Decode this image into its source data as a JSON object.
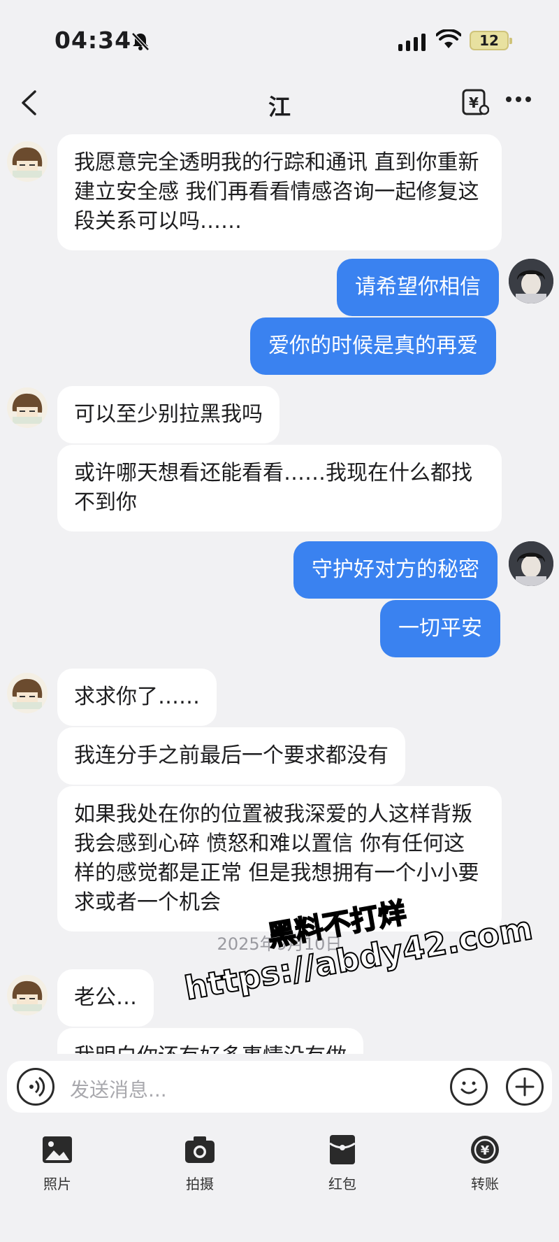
{
  "status": {
    "time": "04:34",
    "battery": "12"
  },
  "header": {
    "title": "江"
  },
  "messages": [
    {
      "side": "in",
      "text": "我愿意完全透明我的行踪和通讯 直到你重新建立安全感 我们再看看情感咨询一起修复这段关系可以吗……"
    },
    {
      "side": "out",
      "text": "请希望你相信"
    },
    {
      "side": "out",
      "text": "爱你的时候是真的再爱"
    },
    {
      "side": "in",
      "text": "可以至少别拉黑我吗"
    },
    {
      "side": "in",
      "text": "或许哪天想看还能看看……我现在什么都找不到你"
    },
    {
      "side": "out",
      "text": "守护好对方的秘密"
    },
    {
      "side": "out",
      "text": "一切平安"
    },
    {
      "side": "in",
      "text": "求求你了……"
    },
    {
      "side": "in",
      "text": "我连分手之前最后一个要求都没有"
    },
    {
      "side": "in",
      "text": "如果我处在你的位置被我深爱的人这样背叛 我会感到心碎 愤怒和难以置信 你有任何这样的感觉都是正常 但是我想拥有一个小小要求或者一个机会"
    },
    {
      "side": "in",
      "text": "老公…"
    },
    {
      "side": "in",
      "text": "我明白你还有好多事情没有做"
    }
  ],
  "date_separator": "2025年9月10日",
  "watermark": {
    "line1": "黑料不打烊",
    "line2": "https://abdy42.com"
  },
  "input": {
    "placeholder": "发送消息..."
  },
  "toolbar": {
    "photo": "照片",
    "camera": "拍摄",
    "red_packet": "红包",
    "transfer": "转账"
  },
  "colors": {
    "outgoing_bubble": "#3a82f0",
    "incoming_bubble": "#ffffff",
    "background": "#f1f1f3"
  }
}
